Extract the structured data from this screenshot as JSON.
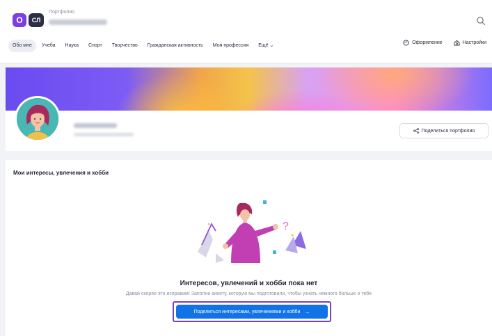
{
  "header": {
    "logo_letter": "O",
    "user_initials": "СЛ",
    "app_title": "Портфолио",
    "search_icon": "search-icon"
  },
  "nav": {
    "items": [
      {
        "label": "Обо мне",
        "active": true
      },
      {
        "label": "Учеба",
        "active": false
      },
      {
        "label": "Наука",
        "active": false
      },
      {
        "label": "Спорт",
        "active": false
      },
      {
        "label": "Творчество",
        "active": false
      },
      {
        "label": "Гражданская активность",
        "active": false
      },
      {
        "label": "Моя профессия",
        "active": false
      }
    ],
    "more_label": "Ещё",
    "design_label": "Оформление",
    "settings_label": "Настройки"
  },
  "profile": {
    "share_label": "Поделиться портфолио"
  },
  "interests": {
    "section_title": "Мои интересы, увлечения и хобби",
    "empty_title": "Интересов, увлечений и хобби пока нет",
    "empty_description": "Давай скорее это исправим! Заполни анкету, которую мы подготовили, чтобы узнать немного больше о тебе",
    "cta_label": "Поделиться интересами, увлечениями и хобби",
    "cta_arrow": "→"
  },
  "colors": {
    "accent_purple": "#7b3fe4",
    "cta_blue": "#1273e6",
    "cta_outline": "#7b3fb8",
    "avatar_teal": "#49b7b3"
  }
}
